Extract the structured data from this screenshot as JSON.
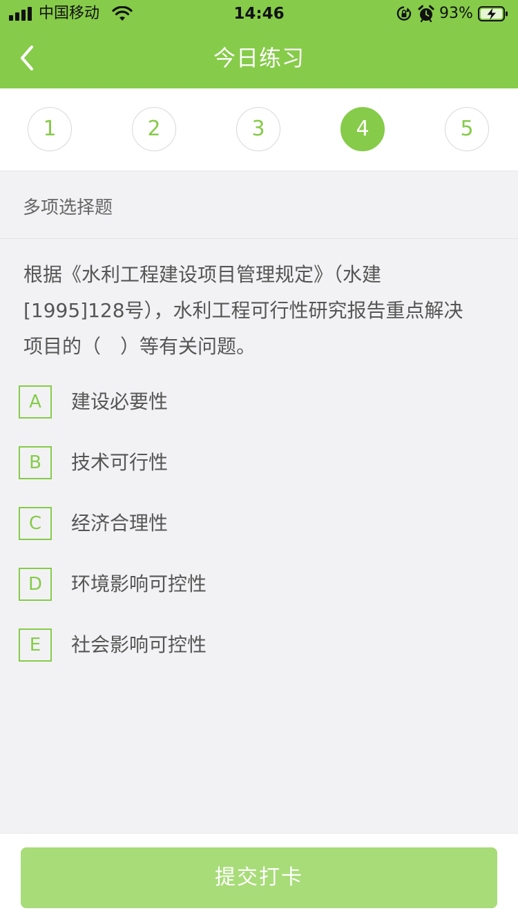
{
  "status_bar": {
    "carrier": "中国移动",
    "time": "14:46",
    "battery_percent": "93%",
    "icons": [
      "signal-icon",
      "wifi-icon",
      "rotation-lock-icon",
      "alarm-icon",
      "battery-charging-icon"
    ]
  },
  "header": {
    "title": "今日练习",
    "back_icon": "chevron-left-icon",
    "background": "#86cb49"
  },
  "question_numbers": {
    "items": [
      "1",
      "2",
      "3",
      "4",
      "5"
    ],
    "current": "4"
  },
  "question": {
    "type": "多项选择题",
    "text_line1": "根据《水利工程建设项目管理规定》（水建",
    "text_line2": "[1995]128号），水利工程可行性研究报告重点解决",
    "text_line3": "项目的（　）等有关问题。",
    "options": [
      {
        "letter": "A",
        "text": "建设必要性"
      },
      {
        "letter": "B",
        "text": "技术可行性"
      },
      {
        "letter": "C",
        "text": "经济合理性"
      },
      {
        "letter": "D",
        "text": "环境影响可控性"
      },
      {
        "letter": "E",
        "text": "社会影响可控性"
      }
    ]
  },
  "submit": {
    "label": "提交打卡"
  },
  "colors": {
    "accent": "#86cb49",
    "button_disabled": "#a8dc79",
    "background": "#f2f2f4"
  }
}
